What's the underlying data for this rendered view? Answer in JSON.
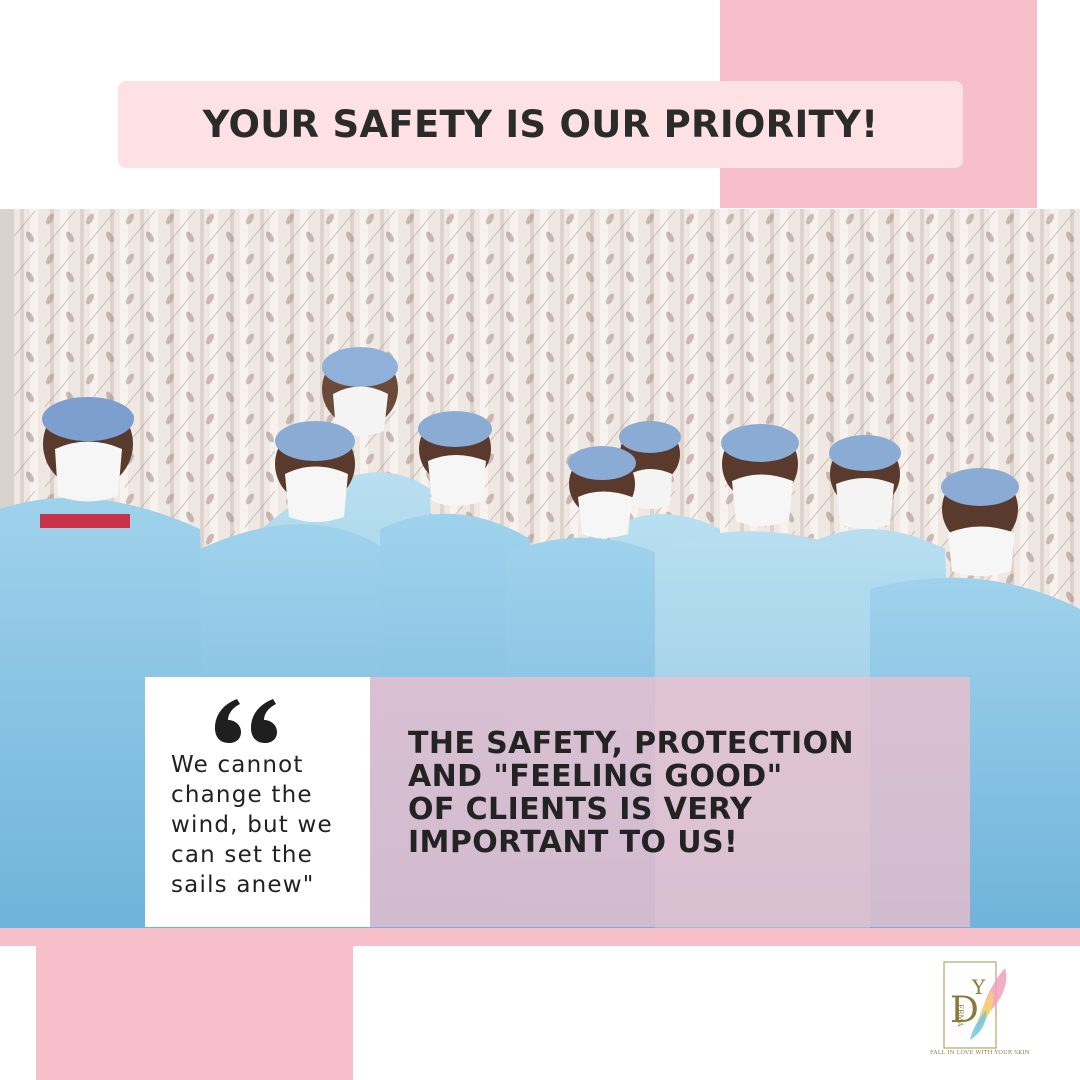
{
  "header": {
    "title": "YOUR SAFETY IS OUR PRIORITY!"
  },
  "photo": {
    "subject": "medical staff in protective gowns",
    "gown_color": "#8ec8e6",
    "curtain_color": "#efe7e2"
  },
  "quote": {
    "icon": "quote-icon",
    "text": "We cannot\nchange the\nwind, but we\ncan set the\nsails anew\""
  },
  "statement": {
    "text": "THE SAFETY, PROTECTION\nAND \"FEELING GOOD\"\nOF CLIENTS IS VERY\nIMPORTANT TO US!"
  },
  "brand": {
    "logo_letters": "DY",
    "logo_word": "ERMA",
    "tagline": "FALL IN LOVE WITH YOUR SKIN"
  },
  "colors": {
    "accent_pink": "#f6bfca",
    "title_box": "#fde1e5",
    "text_dark": "#2b2b2b"
  }
}
